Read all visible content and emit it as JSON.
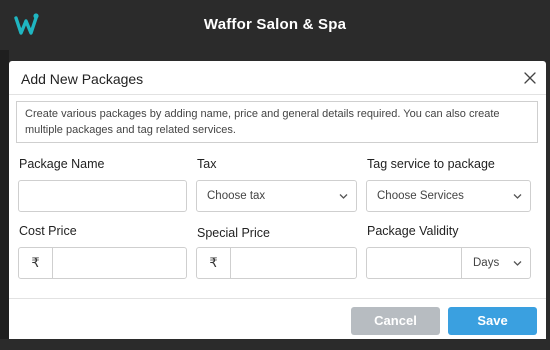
{
  "app": {
    "title": "Waffor Salon & Spa",
    "logo_icon": "w-logo-icon",
    "brand_color": "#1fb6c1"
  },
  "modal": {
    "title": "Add New Packages",
    "info_text": "Create various packages by adding name, price and general details required. You can also create multiple packages and tag related services."
  },
  "fields": {
    "package_name": {
      "label": "Package Name",
      "value": ""
    },
    "tax": {
      "label": "Tax",
      "selected": "Choose tax"
    },
    "tag_service": {
      "label": "Tag service to package",
      "selected": "Choose Services"
    },
    "cost_price": {
      "label": "Cost Price",
      "currency": "₹",
      "value": ""
    },
    "special_price": {
      "label": "Special Price",
      "currency": "₹",
      "value": ""
    },
    "package_validity": {
      "label": "Package Validity",
      "value": "",
      "unit": "Days"
    }
  },
  "footer": {
    "cancel_label": "Cancel",
    "save_label": "Save",
    "cancel_color": "#b7bcc1",
    "save_color": "#3aa0e0"
  }
}
